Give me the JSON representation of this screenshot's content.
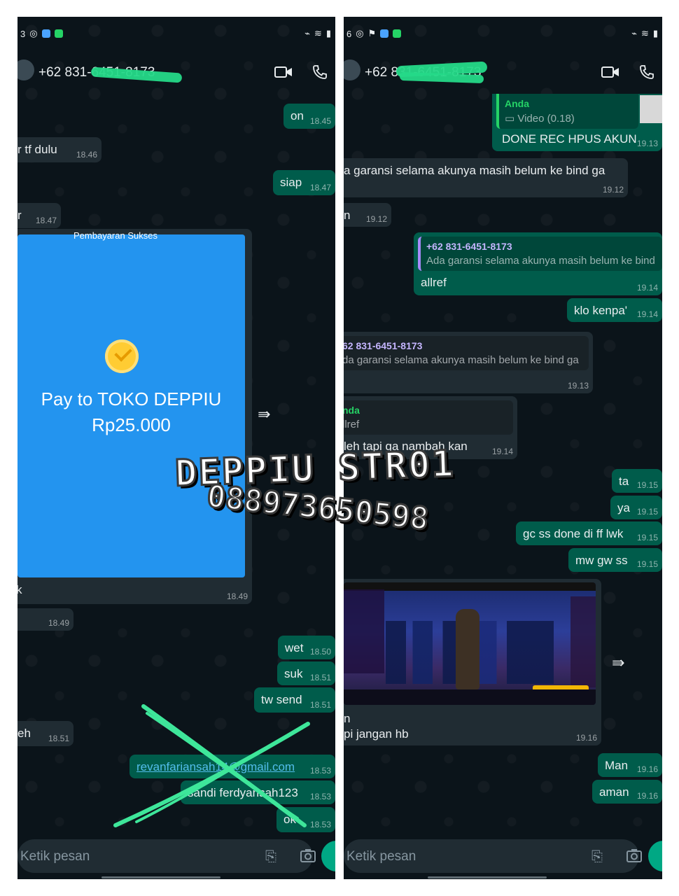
{
  "left": {
    "status": {
      "time_fragment": "3"
    },
    "header": {
      "contact": "+62 831-6451-8173"
    },
    "messages": {
      "m1": {
        "text": "on",
        "time": "18.45"
      },
      "m2": {
        "text": "r tf dulu",
        "time": "18.46"
      },
      "m3": {
        "text": "siap",
        "time": "18.47"
      },
      "m4": {
        "text": "r",
        "time": "18.47"
      },
      "payment": {
        "cut_text": "Pembayaran Sukses",
        "title": "Pay to TOKO DEPPIU",
        "amount": "Rp25.000",
        "caption": "k",
        "time": "18.49"
      },
      "m6": {
        "text": "",
        "time": "18.49"
      },
      "m7": {
        "text": "wet",
        "time": "18.50"
      },
      "m8": {
        "text": "suk",
        "time": "18.51"
      },
      "m9": {
        "text": "tw send",
        "time": "18.51"
      },
      "m10": {
        "text": "eh",
        "time": "18.51"
      },
      "m11": {
        "text": "revanfariansah14@gmail.com",
        "time": "18.53"
      },
      "m12": {
        "text": "sandi ferdyansah123",
        "time": "18.53"
      },
      "m13": {
        "text": "ok",
        "time": "18.53"
      }
    },
    "input": {
      "placeholder": "Ketik pesan"
    }
  },
  "right": {
    "status": {
      "time_fragment": "6"
    },
    "header": {
      "contact": "+62 831-6451-8173"
    },
    "messages": {
      "r1": {
        "quote_name": "Anda",
        "quote_text": "Video (0.18)",
        "text": "DONE REC HPUS AKUN",
        "time": "19.13"
      },
      "r2": {
        "text": "a garansi selama akunya masih belum ke bind ga",
        "time": "19.12"
      },
      "r3": {
        "text": "n",
        "time": "19.12"
      },
      "r4": {
        "quote_name": "+62 831-6451-8173",
        "quote_text": "Ada garansi selama akunya masih belum ke bind",
        "text": "allref",
        "time": "19.14"
      },
      "r5": {
        "text": "klo kenpa'",
        "time": "19.14"
      },
      "r6": {
        "quote_name": "62 831-6451-8173",
        "quote_text": "da garansi selama akunya masih belum ke bind ga",
        "text": "",
        "time": "19.13"
      },
      "r7": {
        "quote_name": "nda",
        "quote_text": "llref",
        "text": "leh tapi ga nambah kan",
        "time": "19.14"
      },
      "r8": {
        "text": "ta",
        "time": "19.15"
      },
      "r9": {
        "text": "ya",
        "time": "19.15"
      },
      "r10": {
        "text": "gc ss done di ff lwk",
        "time": "19.15"
      },
      "r11": {
        "text": "mw gw ss",
        "time": "19.15"
      },
      "r12": {
        "caption_line1": "n",
        "caption_line2": "pi jangan hb",
        "time": "19.16"
      },
      "r13": {
        "text": "Man",
        "time": "19.16"
      },
      "r14": {
        "text": "aman",
        "time": "19.16"
      }
    },
    "input": {
      "placeholder": "Ketik pesan"
    }
  },
  "watermark": {
    "line1": "DEPPIU STR01",
    "line2": "088973650598"
  },
  "colors": {
    "bg": "#0b141a",
    "out": "#005c4b",
    "in": "#202c33",
    "scribble": "#25d988",
    "pay": "#2394ef"
  }
}
